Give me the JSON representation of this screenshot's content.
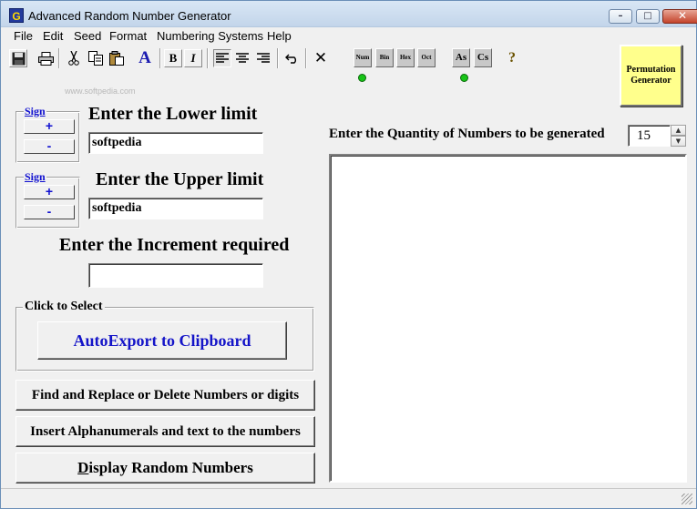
{
  "window": {
    "title": "Advanced Random Number Generator",
    "app_icon_letter": "G"
  },
  "title_buttons": {
    "minimize": "–",
    "maximize": "□",
    "close": "✕"
  },
  "menu": [
    "File",
    "Edit",
    "Seed",
    "Format",
    "Numbering Systems",
    "Help"
  ],
  "toolbar": {
    "save_icon": "floppy-disk-icon",
    "print_icon": "printer-icon",
    "cut_icon": "scissors-icon",
    "copy_icon": "copy-icon",
    "paste_icon": "clipboard-icon",
    "font_color_label": "A",
    "bold_label": "B",
    "italic_label": "I",
    "undo_icon": "undo-arrow-icon",
    "clear_label": "✕",
    "num_label": "Num",
    "bin_label": "Bin",
    "hex_label": "Hex",
    "oct_label": "Oct",
    "lower_label": "As",
    "upper_label": "Cs",
    "help_label": "?",
    "led_color": "#18c418"
  },
  "watermark": "www.softpedia.com",
  "permutation_button": "Permutation Generator",
  "lower": {
    "sign_label": "Sign",
    "plus": "+",
    "minus": "-",
    "label": "Enter the Lower limit",
    "value": "softpedia"
  },
  "upper": {
    "sign_label": "Sign",
    "plus": "+",
    "minus": "-",
    "label": "Enter the Upper limit",
    "value": "softpedia"
  },
  "increment": {
    "label": "Enter the Increment required",
    "value": ""
  },
  "select_group": {
    "label": "Click to Select",
    "autoexport": "AutoExport to Clipboard",
    "autoexport_color": "#1414c8"
  },
  "actions": {
    "find_replace": "Find and Replace or Delete Numbers or digits",
    "insert_alpha": "Insert Alphanumerals and text to the numbers",
    "display_first": "D",
    "display_rest": "isplay Random Numbers"
  },
  "quantity": {
    "label": "Enter the Quantity of Numbers to be generated",
    "value": "15"
  }
}
